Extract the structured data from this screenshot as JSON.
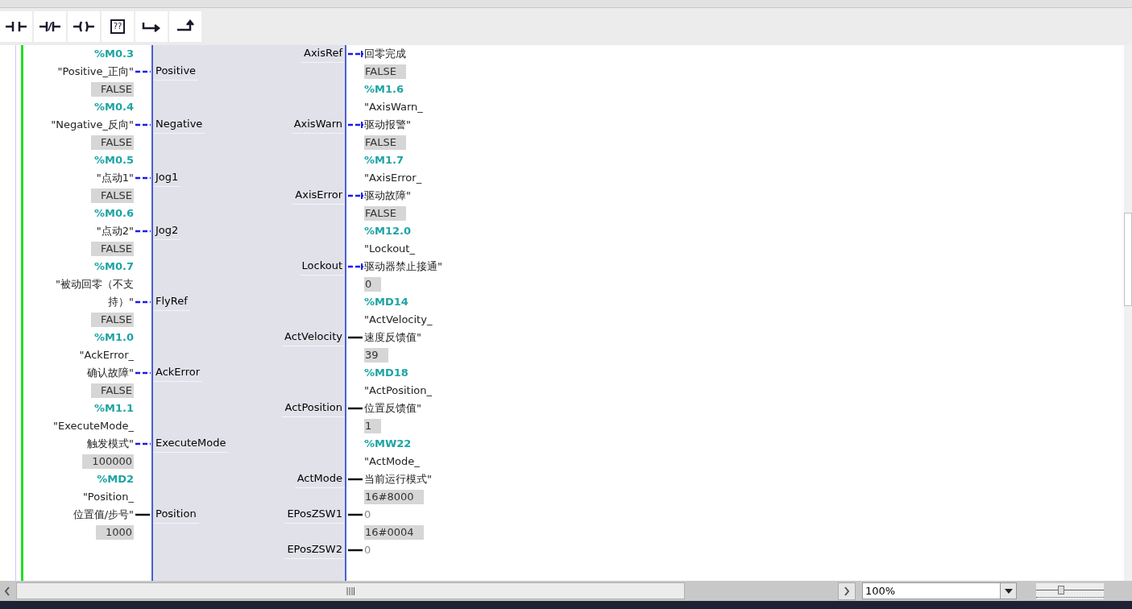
{
  "toolbar": [
    {
      "kind": "no_contact"
    },
    {
      "kind": "nc_contact"
    },
    {
      "kind": "coil"
    },
    {
      "kind": "empty_box",
      "text": "??"
    },
    {
      "kind": "open_branch"
    },
    {
      "kind": "close_branch"
    }
  ],
  "inputs": [
    {
      "address": "%M0.3",
      "symbol": [
        "\"Positive_正向\""
      ],
      "pin": "Positive",
      "kind": "bool"
    },
    {
      "value": "FALSE",
      "address": "%M0.4",
      "symbol": [
        "\"Negative_反向\""
      ],
      "pin": "Negative",
      "kind": "bool"
    },
    {
      "value": "FALSE",
      "address": "%M0.5",
      "symbol": [
        "\"点动1\""
      ],
      "pin": "Jog1",
      "kind": "bool"
    },
    {
      "value": "FALSE",
      "address": "%M0.6",
      "symbol": [
        "\"点动2\""
      ],
      "pin": "Jog2",
      "kind": "bool"
    },
    {
      "value": "FALSE",
      "address": "%M0.7",
      "symbol": [
        "\"被动回零（不支",
        "持）\""
      ],
      "pin": "FlyRef",
      "kind": "bool"
    },
    {
      "value": "FALSE",
      "address": "%M1.0",
      "symbol": [
        "\"AckError_",
        "确认故障\""
      ],
      "pin": "AckError",
      "kind": "bool"
    },
    {
      "value": "FALSE",
      "address": "%M1.1",
      "symbol": [
        "\"ExecuteMode_",
        "触发模式\""
      ],
      "pin": "ExecuteMode",
      "kind": "bool"
    },
    {
      "value": "100000",
      "address": "%MD2",
      "symbol": [
        "\"Position_",
        "位置值/步号\""
      ],
      "pin": "Position",
      "kind": "word"
    },
    {
      "value": "1000"
    }
  ],
  "outputs": [
    {
      "symbol": [
        "回零完成"
      ],
      "pin": "AxisRef",
      "kind": "bool"
    },
    {
      "value": "FALSE",
      "address": "%M1.6",
      "symbol": [
        "\"AxisWarn_",
        "驱动报警\""
      ],
      "pin": "AxisWarn",
      "kind": "bool"
    },
    {
      "value": "FALSE",
      "address": "%M1.7",
      "symbol": [
        "\"AxisError_",
        "驱动故障\""
      ],
      "pin": "AxisError",
      "kind": "bool"
    },
    {
      "value": "FALSE",
      "address": "%M12.0",
      "symbol": [
        "\"Lockout_",
        "驱动器禁止接通\""
      ],
      "pin": "Lockout",
      "kind": "bool"
    },
    {
      "value": "0",
      "address": "%MD14",
      "symbol": [
        "\"ActVelocity_",
        "速度反馈值\""
      ],
      "pin": "ActVelocity",
      "kind": "word"
    },
    {
      "value": "39",
      "address": "%MD18",
      "symbol": [
        "\"ActPosition_",
        "位置反馈值\""
      ],
      "pin": "ActPosition",
      "kind": "word"
    },
    {
      "value": "1",
      "address": "%MW22",
      "symbol": [
        "\"ActMode_",
        "当前运行模式\""
      ],
      "pin": "ActMode",
      "kind": "word"
    },
    {
      "value": "16#8000",
      "constant": "0",
      "pin": "EPosZSW1",
      "kind": "word"
    },
    {
      "value": "16#0004",
      "constant": "0",
      "pin": "EPosZSW2",
      "kind": "word"
    }
  ],
  "zoom": {
    "value": "100%",
    "level": 0.37
  }
}
